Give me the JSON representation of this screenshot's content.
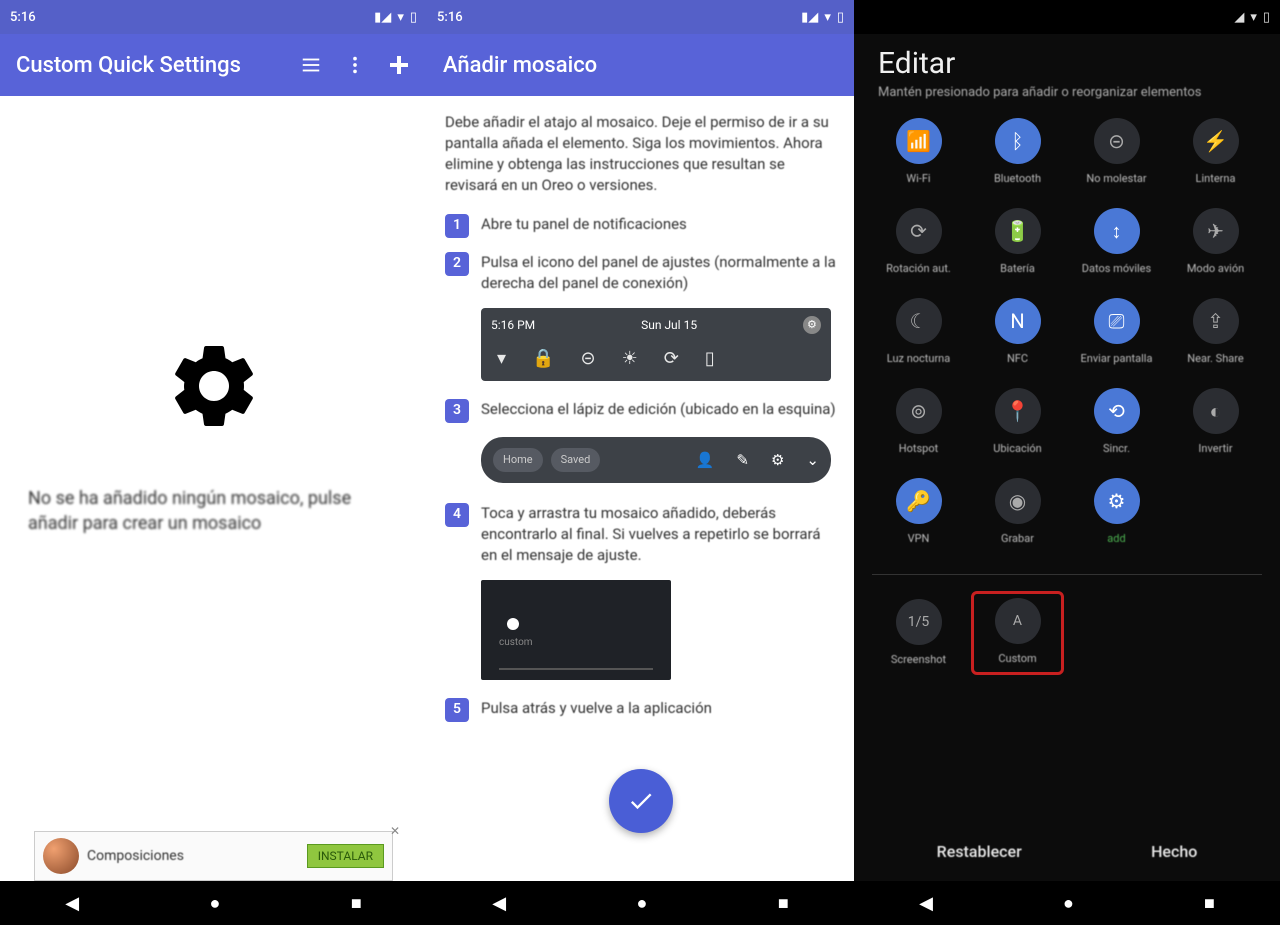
{
  "phone1": {
    "status_time": "5:16",
    "appbar_title": "Custom Quick Settings",
    "empty_text": "No se ha añadido ningún mosaico, pulse añadir para crear un mosaico"
  },
  "phone2": {
    "status_time": "5:16",
    "appbar_title": "Añadir mosaico",
    "intro": "Debe añadir el atajo al mosaico. Deje el permiso de ir a su pantalla añada el elemento. Siga los movimientos. Ahora elimine y obtenga las instrucciones que resultan se revisará en un Oreo o versiones.",
    "steps": [
      "Abre tu panel de notificaciones",
      "Pulsa el icono del panel de ajustes (normalmente a la derecha del panel de conexión)",
      "Selecciona el lápiz de edición (ubicado en la esquina)",
      "Toca y arrastra tu mosaico añadido, deberás encontrarlo al final. Si vuelves a repetirlo se borrará en el mensaje de ajuste.",
      "Pulsa atrás y vuelve a la aplicación"
    ],
    "qs_time": "5:16 PM",
    "qs_date": "Sun Jul 15",
    "qs2_left": [
      "Home",
      "Saved"
    ],
    "ad_title": "Composiciones",
    "ad_button": "INSTALAR"
  },
  "phone3": {
    "title": "Editar",
    "subtitle": "Mantén presionado para añadir o reorganizar elementos",
    "tiles": [
      {
        "name": "wifi-tile",
        "icon": "wifi",
        "label": "Wi-Fi",
        "state": "on"
      },
      {
        "name": "bluetooth-tile",
        "icon": "bluetooth",
        "label": "Bluetooth",
        "state": "on"
      },
      {
        "name": "dnd-tile",
        "icon": "dnd",
        "label": "No molestar",
        "state": "off"
      },
      {
        "name": "flashlight-tile",
        "icon": "flash",
        "label": "Linterna",
        "state": "off"
      },
      {
        "name": "rotation-tile",
        "icon": "rotate",
        "label": "Rotación aut.",
        "state": "off"
      },
      {
        "name": "battery-tile",
        "icon": "battery",
        "label": "Batería",
        "state": "off"
      },
      {
        "name": "data-tile",
        "icon": "data",
        "label": "Datos móviles",
        "state": "on"
      },
      {
        "name": "airplane-tile",
        "icon": "plane",
        "label": "Modo avión",
        "state": "off"
      },
      {
        "name": "nightlight-tile",
        "icon": "night",
        "label": "Luz nocturna",
        "state": "off"
      },
      {
        "name": "nfc-tile",
        "icon": "nfc",
        "label": "NFC",
        "state": "on"
      },
      {
        "name": "cast-tile",
        "icon": "cast",
        "label": "Enviar pantalla",
        "state": "on"
      },
      {
        "name": "nearby-tile",
        "icon": "share",
        "label": "Near. Share",
        "state": "off"
      },
      {
        "name": "hotspot-tile",
        "icon": "hotspot",
        "label": "Hotspot",
        "state": "off"
      },
      {
        "name": "location-tile",
        "icon": "location",
        "label": "Ubicación",
        "state": "off"
      },
      {
        "name": "sync-tile",
        "icon": "sync",
        "label": "Sincr.",
        "state": "on"
      },
      {
        "name": "invert-tile",
        "icon": "invert",
        "label": "Invertir",
        "state": "off"
      },
      {
        "name": "vpn-tile",
        "icon": "vpn",
        "label": "VPN",
        "state": "on"
      },
      {
        "name": "record-tile",
        "icon": "record",
        "label": "Grabar",
        "state": "off"
      },
      {
        "name": "custom-tile",
        "icon": "gear",
        "label": "add",
        "state": "on",
        "green": true
      }
    ],
    "extra": [
      {
        "name": "extra-1",
        "text": "1/5",
        "label": "Screenshot"
      },
      {
        "name": "extra-2",
        "text": "A",
        "label": "Custom",
        "highlight": true
      }
    ],
    "action_left": "Restablecer",
    "action_right": "Hecho"
  }
}
